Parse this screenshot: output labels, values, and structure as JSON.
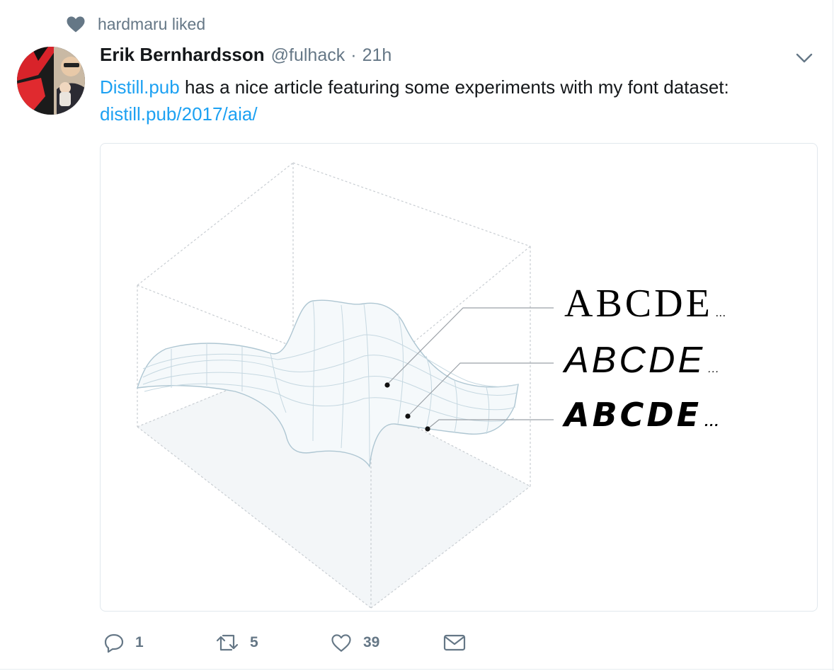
{
  "social_context": {
    "icon": "heart-icon",
    "text": "hardmaru liked"
  },
  "author": {
    "name": "Erik Bernhardsson",
    "handle": "@fulhack",
    "separator": "·",
    "time": "21h"
  },
  "tweet": {
    "link1": "Distill.pub",
    "text": " has a nice article featuring some experiments with my font dataset:",
    "link2": "distill.pub/2017/aia/"
  },
  "media": {
    "rows": [
      {
        "letters": "ABCDE",
        "ellipsis": "..."
      },
      {
        "letters": "ABCDE",
        "ellipsis": "..."
      },
      {
        "letters": "ABCDE",
        "ellipsis": "..."
      }
    ]
  },
  "actions": {
    "reply_count": "1",
    "retweet_count": "5",
    "like_count": "39"
  },
  "colors": {
    "link": "#1da1f2",
    "muted": "#657786",
    "text": "#14171a",
    "surface_line": "#a9c4d3"
  }
}
